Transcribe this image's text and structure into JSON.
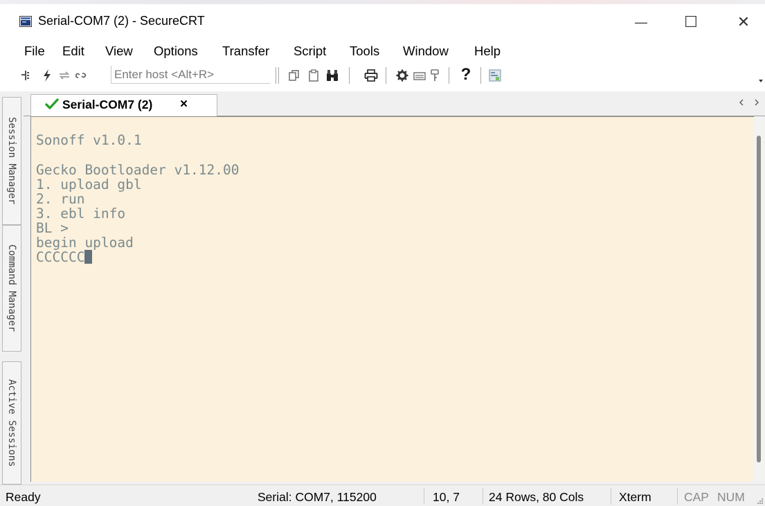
{
  "window": {
    "title": "Serial-COM7 (2) - SecureCRT",
    "minimize_glyph": "—",
    "maximize_glyph": "☐",
    "close_glyph": "✕"
  },
  "menu": {
    "items": [
      "File",
      "Edit",
      "View",
      "Options",
      "Transfer",
      "Script",
      "Tools",
      "Window",
      "Help"
    ]
  },
  "toolbar": {
    "host_placeholder": "Enter host <Alt+R>",
    "help_glyph": "?",
    "icons": [
      "connect-bar-icon",
      "quick-connect-icon",
      "reconnect-icon",
      "disconnect-icon",
      "copy-icon",
      "paste-icon",
      "find-icon",
      "print-icon",
      "settings-icon",
      "keymap-icon",
      "key-icon",
      "help-icon",
      "sftp-icon",
      "overflow-icon"
    ]
  },
  "side_tabs": [
    "Session Manager",
    "Command Manager",
    "Active Sessions"
  ],
  "tab": {
    "label": "Serial-COM7 (2)",
    "close_glyph": "×"
  },
  "terminal": {
    "lines": [
      "Sonoff v1.0.1",
      "",
      "Gecko Bootloader v1.12.00",
      "1. upload gbl",
      "2. run",
      "3. ebl info",
      "BL >",
      "begin upload",
      "CCCCCC"
    ],
    "background": "#fbf1dd",
    "text_color": "#7c8a8d"
  },
  "status": {
    "ready": "Ready",
    "connection": "Serial: COM7, 115200",
    "cursor_pos": "10,  7",
    "size": "24 Rows, 80 Cols",
    "emulation": "Xterm",
    "cap": "CAP",
    "num": "NUM"
  },
  "colors": {
    "check_green": "#2aa02a",
    "title_bg": "#ffffff",
    "chrome_bg": "#f0f0f0"
  }
}
